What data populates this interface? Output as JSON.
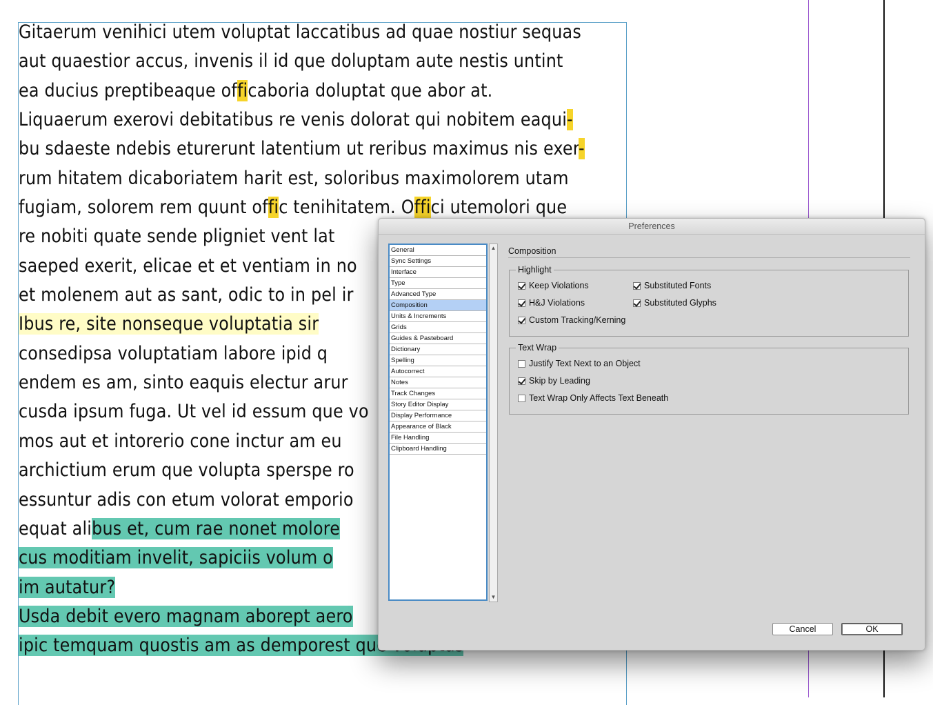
{
  "document": {
    "lines": [
      [
        {
          "t": "Gitaerum venihici utem voluptat laccatibus ad quae nostiur sequas"
        }
      ],
      [
        {
          "t": "aut quaestior accus, invenis il id que doluptam aute nestis untint"
        }
      ],
      [
        {
          "t": "ea ducius preptibeaque of"
        },
        {
          "t": "fi",
          "h": "y"
        },
        {
          "t": "caboria doluptat que abor at."
        }
      ],
      [
        {
          "t": "Liquaerum exerovi debitatibus re venis dolorat qui nobitem eaqui"
        },
        {
          "t": "-",
          "h": "y"
        }
      ],
      [
        {
          "t": "bu sdaeste ndebis eturerunt latentium ut reribus maximus nis exer"
        },
        {
          "t": "-",
          "h": "y"
        }
      ],
      [
        {
          "t": "rum hitatem dicaboriatem harit est, soloribus maximolorem utam"
        }
      ],
      [
        {
          "t": "fugiam, solorem rem quunt of"
        },
        {
          "t": "fi",
          "h": "y"
        },
        {
          "t": "c tenihitatem. O"
        },
        {
          "t": "ffi",
          "h": "y"
        },
        {
          "t": "ci utemolori que"
        }
      ],
      [
        {
          "t": "re nobiti quate sende pligniet vent lat"
        }
      ],
      [
        {
          "t": "saeped exerit, elicae et et ventiam in no"
        }
      ],
      [
        {
          "t": "et molenem aut as sant, odic to in pel ir"
        }
      ],
      [
        {
          "t": "Ibus re, site nonseque voluptatia sir",
          "h": "ly"
        }
      ],
      [
        {
          "t": "consedipsa voluptatiam labore ipid q"
        }
      ],
      [
        {
          "t": "endem es am, sinto eaquis electur arur"
        }
      ],
      [
        {
          "t": "cusda ipsum fuga. Ut vel id essum que vo"
        }
      ],
      [
        {
          "t": "mos aut et intorerio cone inctur am eu"
        }
      ],
      [
        {
          "t": "archictium erum que volupta sperspe ro"
        }
      ],
      [
        {
          "t": "essuntur adis con etum volorat emporio"
        }
      ],
      [
        {
          "t": "equat ali"
        },
        {
          "t": "bus et, cum rae nonet molore",
          "h": "t"
        }
      ],
      [
        {
          "t": "cus moditiam invelit, sapiciis volum o",
          "h": "t"
        }
      ],
      [
        {
          "t": "im autatur? ",
          "h": "t"
        }
      ],
      [
        {
          "t": "Usda debit evero magnam aborept aero",
          "h": "t"
        }
      ],
      [
        {
          "t": "ipic temquam quostis am as demporest que voluptas ",
          "h": "t"
        }
      ]
    ]
  },
  "dialog": {
    "title": "Preferences",
    "categories": [
      "General",
      "Sync Settings",
      "Interface",
      "Type",
      "Advanced Type",
      "Composition",
      "Units & Increments",
      "Grids",
      "Guides & Pasteboard",
      "Dictionary",
      "Spelling",
      "Autocorrect",
      "Notes",
      "Track Changes",
      "Story Editor Display",
      "Display Performance",
      "Appearance of Black",
      "File Handling",
      "Clipboard Handling"
    ],
    "selected_category": "Composition",
    "section_title": "Composition",
    "highlight": {
      "legend": "Highlight",
      "keep_violations": {
        "label": "Keep Violations",
        "checked": true
      },
      "substituted_fonts": {
        "label": "Substituted Fonts",
        "checked": true
      },
      "hj_violations": {
        "label": "H&J Violations",
        "checked": true
      },
      "substituted_glyphs": {
        "label": "Substituted Glyphs",
        "checked": true
      },
      "custom_tracking": {
        "label": "Custom Tracking/Kerning",
        "checked": true
      }
    },
    "text_wrap": {
      "legend": "Text Wrap",
      "justify_next_to_object": {
        "label": "Justify Text Next to an Object",
        "checked": false
      },
      "skip_by_leading": {
        "label": "Skip by Leading",
        "checked": true
      },
      "only_affects_beneath": {
        "label": "Text Wrap Only Affects Text Beneath",
        "checked": false
      }
    },
    "buttons": {
      "cancel": "Cancel",
      "ok": "OK"
    }
  }
}
